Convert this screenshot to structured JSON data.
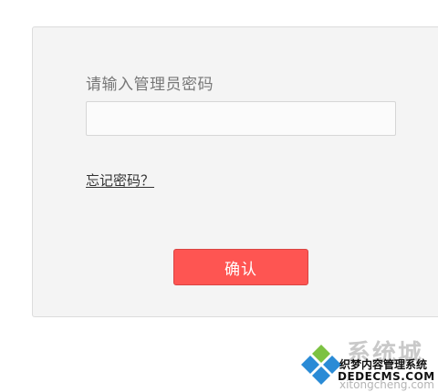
{
  "login": {
    "prompt_label": "请输入管理员密码",
    "password_value": "",
    "forgot_link": "忘记密码？",
    "confirm_button": "确认"
  },
  "watermark": {
    "title": "系统城",
    "subtitle": "织梦内容管理系统",
    "domain": "DEDECMS.COM",
    "url": "xitongcheng.com"
  },
  "colors": {
    "panel_bg": "#f4f4f4",
    "button_bg": "#fe5552",
    "label_text": "#777777",
    "logo_blue": "#2a8bd6",
    "logo_green": "#7cc242"
  }
}
